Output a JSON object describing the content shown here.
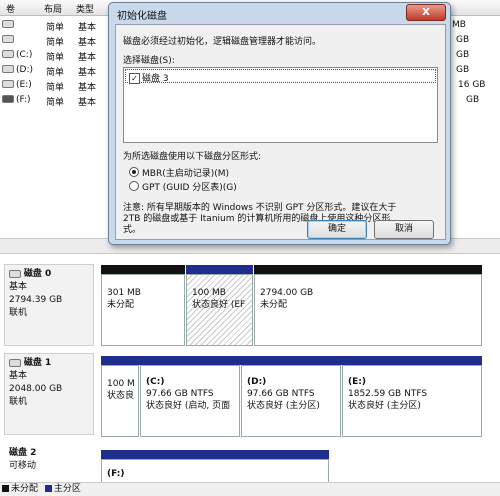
{
  "columns": [
    "卷",
    "布局",
    "类型"
  ],
  "right_col": [
    "MB",
    "GB",
    "GB",
    "GB",
    "16 GB",
    "GB"
  ],
  "volumes": [
    {
      "name": "",
      "layout": "简单",
      "type": "基本"
    },
    {
      "name": "",
      "layout": "简单",
      "type": "基本"
    },
    {
      "name": "(C:)",
      "layout": "简单",
      "type": "基本"
    },
    {
      "name": "(D:)",
      "layout": "简单",
      "type": "基本"
    },
    {
      "name": "(E:)",
      "layout": "简单",
      "type": "基本"
    },
    {
      "name": "(F:)",
      "layout": "简单",
      "type": "基本"
    }
  ],
  "dialog": {
    "title": "初始化磁盘",
    "close": "X",
    "intro": "磁盘必须经过初始化，逻辑磁盘管理器才能访问。",
    "select_label": "选择磁盘(S):",
    "disk_item": "磁盘 3",
    "style_label": "为所选磁盘使用以下磁盘分区形式:",
    "mbr": "MBR(主启动记录)(M)",
    "gpt": "GPT (GUID 分区表)(G)",
    "note1": "注意: 所有早期版本的 Windows 不识别 GPT 分区形式。建议在大于",
    "note2": "2TB 的磁盘或基于 Itanium 的计算机所用的磁盘上使用这种分区形",
    "note3": "式。",
    "ok": "确定",
    "cancel": "取消"
  },
  "disks": [
    {
      "name": "磁盘 0",
      "type": "基本",
      "size": "2794.39 GB",
      "status": "联机",
      "parts": [
        {
          "size": "301 MB",
          "status": "未分配"
        },
        {
          "size": "100 MB",
          "status": "状态良好 (EF"
        },
        {
          "size": "2794.00 GB",
          "status": "未分配"
        }
      ]
    },
    {
      "name": "磁盘 1",
      "type": "基本",
      "size": "2048.00 GB",
      "status": "联机",
      "parts": [
        {
          "label": "",
          "size": "100 M",
          "status": "状态良"
        },
        {
          "label": "(C:)",
          "size": "97.66 GB NTFS",
          "status": "状态良好 (启动, 页面"
        },
        {
          "label": "(D:)",
          "size": "97.66 GB NTFS",
          "status": "状态良好 (主分区)"
        },
        {
          "label": "(E:)",
          "size": "1852.59 GB NTFS",
          "status": "状态良好 (主分区)"
        }
      ]
    },
    {
      "name": "磁盘 2",
      "type": "可移动",
      "parts": [
        {
          "label": "(F:)"
        }
      ]
    }
  ],
  "legend": {
    "unallocated": "未分配",
    "primary": "主分区"
  },
  "colors": {
    "unallocated": "#111111",
    "primary": "#1f2d8f",
    "dialog_frame": "#c9d9ec"
  }
}
